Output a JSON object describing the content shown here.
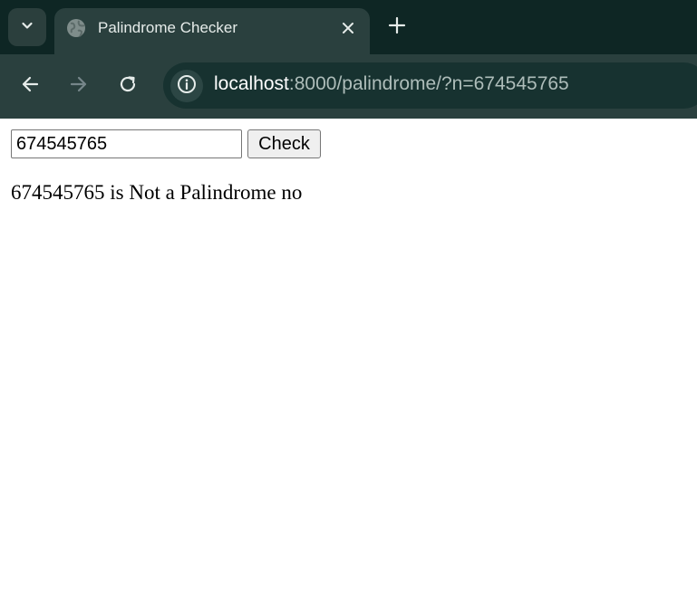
{
  "browser": {
    "tab": {
      "title": "Palindrome Checker"
    },
    "address_bar": {
      "host": "localhost",
      "rest": ":8000/palindrome/?n=674545765"
    }
  },
  "page": {
    "input": {
      "value": "674545765"
    },
    "check_button_label": "Check",
    "result_text": "674545765 is Not a Palindrome no"
  },
  "colors": {
    "tabstrip_bg": "#0e2624",
    "toolbar_bg": "#2a403e",
    "omnibox_bg": "#173230"
  },
  "icons": [
    "tab-search-icon",
    "globe-icon",
    "close-icon",
    "plus-icon",
    "back-arrow-icon",
    "forward-arrow-icon",
    "reload-icon",
    "info-icon"
  ]
}
